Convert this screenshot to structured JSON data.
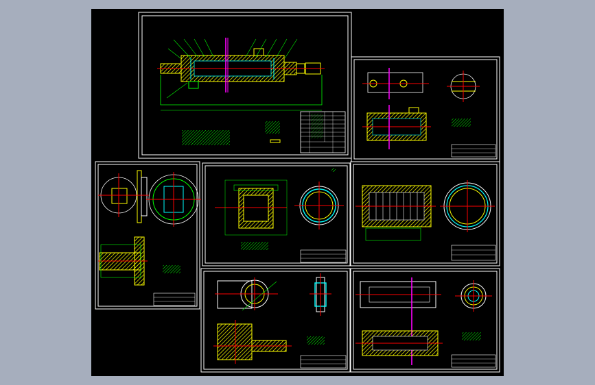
{
  "viewer": {
    "background_color": "#a6aebd",
    "canvas_color": "#000000"
  },
  "palette": {
    "frame": "#ffffff",
    "centerline": "#ff0000",
    "hatch": "#ffff00",
    "outline": "#00ff00",
    "accent": "#00ffff",
    "marker": "#ff00ff"
  },
  "sheets": [
    {
      "id": "assembly-drawing"
    },
    {
      "id": "part-housing-flange"
    },
    {
      "id": "part-bracket"
    },
    {
      "id": "part-nut-sleeve"
    },
    {
      "id": "part-threaded-sleeve"
    },
    {
      "id": "part-eye-end"
    },
    {
      "id": "part-shaft"
    }
  ]
}
